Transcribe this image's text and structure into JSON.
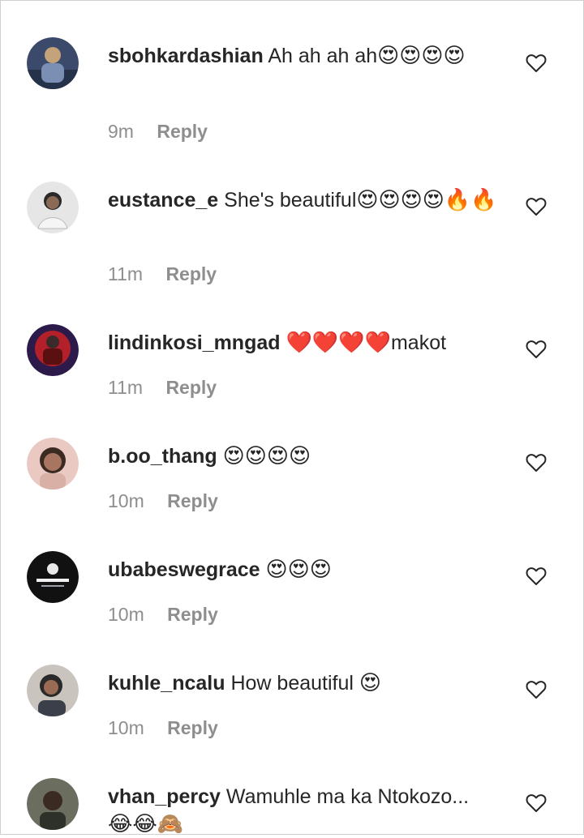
{
  "comments": [
    {
      "username": "sbohkardashian",
      "text": "Ah ah ah ah",
      "emoji": "😍😍😍😍",
      "time": "9m",
      "reply_label": "Reply",
      "avatar_color": "#3b4a6b"
    },
    {
      "username": "eustance_e",
      "text": "She's beautiful",
      "emoji": "😍😍😍😍🔥🔥",
      "time": "11m",
      "reply_label": "Reply",
      "avatar_color": "#d9d9d9"
    },
    {
      "username": "lindinkosi_mngad",
      "text": "makot",
      "emoji": "❤️❤️❤️❤️",
      "time": "11m",
      "reply_label": "Reply",
      "avatar_color": "#b3202a"
    },
    {
      "username": "b.oo_thang",
      "text": "",
      "emoji": "😍😍😍😍",
      "time": "10m",
      "reply_label": "Reply",
      "avatar_color": "#c98f86"
    },
    {
      "username": "ubabeswegrace",
      "text": "",
      "emoji": "😍😍😍",
      "time": "10m",
      "reply_label": "Reply",
      "avatar_color": "#111111"
    },
    {
      "username": "kuhle_ncalu",
      "text": "How beautiful",
      "emoji": "😍",
      "time": "10m",
      "reply_label": "Reply",
      "avatar_color": "#5a5f6b"
    },
    {
      "username": "vhan_percy",
      "text": "Wamuhle ma ka Ntokozo...",
      "emoji": "😂😂🙈",
      "time": "",
      "reply_label": "",
      "avatar_color": "#4c4f45"
    }
  ],
  "icons": {
    "like": "heart-outline-icon"
  },
  "colors": {
    "meta_text": "#8e8e8e",
    "primary_text": "#262626",
    "background": "#ffffff"
  }
}
